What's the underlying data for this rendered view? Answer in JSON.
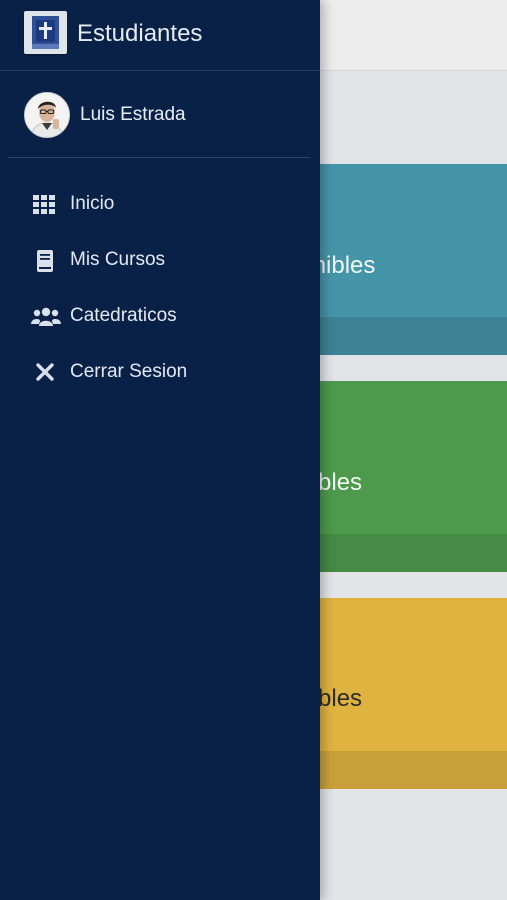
{
  "background": {
    "cards": [
      {
        "title_fragment": "ponibles",
        "color": "#4595a9"
      },
      {
        "title_fragment": "onibles",
        "color": "#4d9a4d"
      },
      {
        "title_fragment": "onibles",
        "color": "#e0b23f"
      }
    ]
  },
  "drawer": {
    "app_title": "Estudiantes",
    "user": {
      "name": "Luis Estrada"
    },
    "items": [
      {
        "label": "Inicio",
        "icon": "grid-icon"
      },
      {
        "label": "Mis Cursos",
        "icon": "book-icon"
      },
      {
        "label": "Catedraticos",
        "icon": "users-icon"
      },
      {
        "label": "Cerrar Sesion",
        "icon": "close-icon"
      }
    ],
    "colors": {
      "background": "#0a2147",
      "text": "#e4e9f1"
    }
  }
}
